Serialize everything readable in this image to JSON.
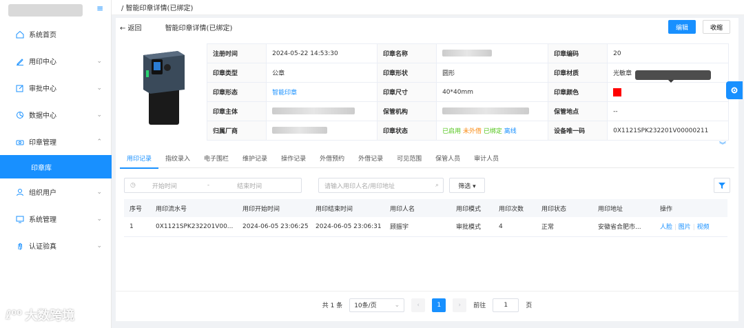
{
  "sidebar": {
    "items": [
      {
        "label": "系统首页",
        "icon": "home-icon"
      },
      {
        "label": "用印中心",
        "icon": "pen-icon"
      },
      {
        "label": "审批中心",
        "icon": "edit-icon"
      },
      {
        "label": "数据中心",
        "icon": "data-icon"
      },
      {
        "label": "印章管理",
        "icon": "stamp-icon"
      },
      {
        "label": "组织用户",
        "icon": "user-icon"
      },
      {
        "label": "系统管理",
        "icon": "monitor-icon"
      },
      {
        "label": "认证验真",
        "icon": "hand-icon"
      }
    ],
    "sub_active": "印章库"
  },
  "breadcrumb": "/ 智能印章详情(已绑定)",
  "header": {
    "back": "← 返回",
    "title": "智能印章详情(已绑定)",
    "edit": "编辑",
    "collapse": "收缩"
  },
  "info": {
    "reg_time_label": "注册时间",
    "reg_time": "2024-05-22 14:53:30",
    "seal_name_label": "印章名称",
    "seal_code_label": "印章编码",
    "seal_code": "20",
    "seal_type_label": "印章类型",
    "seal_type": "公章",
    "seal_shape_label": "印章形状",
    "seal_shape": "圆形",
    "seal_material_label": "印章材质",
    "seal_material": "光敏章",
    "seal_form_label": "印章形态",
    "seal_form": "智能印章",
    "seal_size_label": "印章尺寸",
    "seal_size": "40*40mm",
    "seal_color_label": "印章颜色",
    "seal_color": "#ff0000",
    "seal_owner_label": "印章主体",
    "custody_org_label": "保管机构",
    "custody_place_label": "保管地点",
    "custody_place": "--",
    "vendor_label": "归属厂商",
    "seal_status_label": "印章状态",
    "status_enabled": "已启用",
    "status_not_lent": "未外借",
    "status_bound": "已绑定",
    "status_offline": "离线",
    "device_id_label": "设备唯一码",
    "device_id": "0X1121SPK232201V00000211"
  },
  "tabs": [
    "用印记录",
    "指纹录入",
    "电子围栏",
    "维护记录",
    "操作记录",
    "外借预约",
    "外借记录",
    "可见范围",
    "保管人员",
    "审计人员"
  ],
  "filter": {
    "start_placeholder": "开始时间",
    "sep": "-",
    "end_placeholder": "结束时间",
    "search_placeholder": "请输入用印人名/用印地址",
    "screen": "筛选 ▾"
  },
  "table": {
    "headers": [
      "序号",
      "用印流水号",
      "用印开始时间",
      "用印结束时间",
      "用印人名",
      "用印模式",
      "用印次数",
      "用印状态",
      "用印地址",
      "操作"
    ],
    "rows": [
      {
        "no": "1",
        "serial": "0X1121SPK232201V00...",
        "start": "2024-06-05 23:06:25",
        "end": "2024-06-05 23:06:31",
        "user": "顾振宇",
        "mode": "审批模式",
        "count": "4",
        "status": "正常",
        "addr": "安徽省合肥市...",
        "op_face": "人脸",
        "op_img": "图片",
        "op_video": "视频"
      }
    ]
  },
  "pager": {
    "total": "共 1 条",
    "size": "10条/页",
    "current": "1",
    "goto": "前往",
    "goto_value": "1",
    "page_suffix": "页"
  },
  "watermark": "大数跨境",
  "colors": {
    "accent": "#1890ff",
    "enabled": "#52c41a",
    "not_lent": "#fa8c16",
    "bound": "#52c41a",
    "offline": "#1890ff"
  }
}
